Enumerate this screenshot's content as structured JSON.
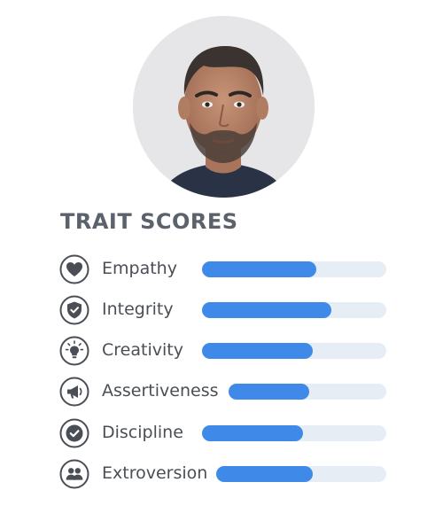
{
  "profile": {
    "avatar_icon": "person-portrait-photo"
  },
  "section": {
    "title": "TRAIT SCORES"
  },
  "colors": {
    "bar_fill": "#3f8ae9",
    "bar_track": "#e7edf5",
    "icon_stroke": "#4a4e55",
    "title": "#5c626b"
  },
  "traits": [
    {
      "label": "Empathy",
      "icon": "heart-icon",
      "score": 0.62
    },
    {
      "label": "Integrity",
      "icon": "shield-check-icon",
      "score": 0.7
    },
    {
      "label": "Creativity",
      "icon": "lightbulb-icon",
      "score": 0.6
    },
    {
      "label": "Assertiveness",
      "icon": "megaphone-icon",
      "score": 0.51
    },
    {
      "label": "Discipline",
      "icon": "check-circle-icon",
      "score": 0.55
    },
    {
      "label": "Extroversion",
      "icon": "people-icon",
      "score": 0.57
    }
  ]
}
